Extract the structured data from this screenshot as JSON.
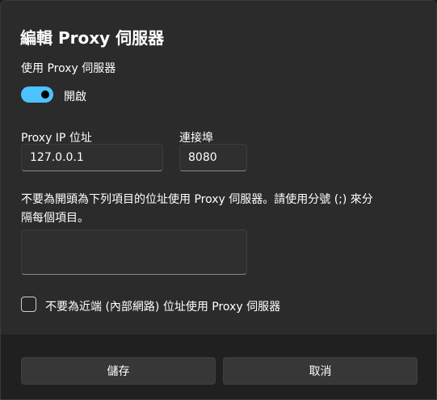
{
  "background": {
    "peek_text": ""
  },
  "dialog": {
    "title": "編輯 Proxy 伺服器",
    "use_proxy": {
      "label": "使用 Proxy 伺服器",
      "toggle_on": true,
      "toggle_state_label": "開啟"
    },
    "proxy_ip": {
      "label": "Proxy IP 位址",
      "value": "127.0.0.1"
    },
    "port": {
      "label": "連接埠",
      "value": "8080"
    },
    "exceptions": {
      "description_line1": "不要為開頭為下列項目的位址使用 Proxy 伺服器。請使用分號 (;) 來分",
      "description_line2": "隔每個項目。",
      "value": ""
    },
    "bypass_local": {
      "label": "不要為近端 (內部網路) 位址使用 Proxy 伺服器",
      "checked": false
    },
    "buttons": {
      "save": "儲存",
      "cancel": "取消"
    }
  },
  "colors": {
    "accent": "#4cc2ff",
    "dialog_bg": "#2b2b2b",
    "footer_bg": "#202020",
    "field_bg": "#2f2f2f"
  }
}
